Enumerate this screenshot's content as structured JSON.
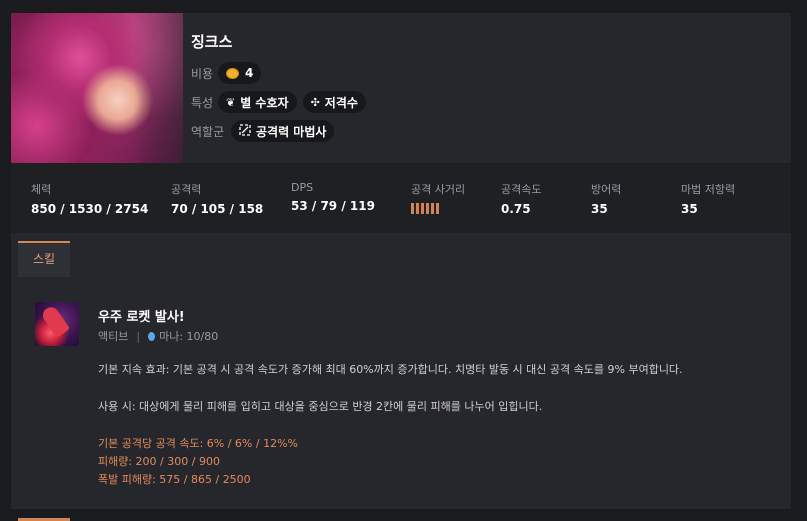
{
  "champion": {
    "name": "징크스",
    "cost_label": "비용",
    "cost_value": "4",
    "traits_label": "특성",
    "traits": [
      {
        "icon": "star-guardian-icon",
        "glyph": "❦",
        "label": "별 수호자"
      },
      {
        "icon": "sniper-icon",
        "glyph": "✣",
        "label": "저격수"
      }
    ],
    "role_label": "역할군",
    "role": {
      "icon": "ad-caster-icon",
      "label": "공격력 마법사"
    }
  },
  "stats": [
    {
      "label": "체력",
      "value": "850 / 1530 / 2754"
    },
    {
      "label": "공격력",
      "value": "70 / 105 / 158"
    },
    {
      "label": "DPS",
      "value": "53 / 79 / 119"
    },
    {
      "label": "공격 사거리",
      "range_bars": 6
    },
    {
      "label": "공격속도",
      "value": "0.75"
    },
    {
      "label": "방어력",
      "value": "35"
    },
    {
      "label": "마법 저항력",
      "value": "35"
    }
  ],
  "tabs": [
    {
      "label": "스킬",
      "active": true
    }
  ],
  "skill": {
    "name": "우주 로켓 발사!",
    "type": "액티브",
    "separator": "|",
    "mana": "마나: 10/80",
    "passive_text": "기본 지속 효과: 기본 공격 시 공격 속도가 증가해 최대 60%까지 증가합니다. 치명타 발동 시 대신 공격 속도를 9% 부여합니다.",
    "active_text": "사용 시: 대상에게 물리 피해를 입히고 대상을 중심으로 반경 2칸에 물리 피해를 나누어 입힙니다.",
    "scalings": [
      "기본 공격당 공격 속도: 6% / 6% / 12%%",
      "피해량: 200 / 300 / 900",
      "폭발 피해량: 575 / 865 / 2500"
    ]
  },
  "colors": {
    "accent": "#d18552",
    "scaling_text": "#e38a5a",
    "background": "#1a1b1f"
  }
}
